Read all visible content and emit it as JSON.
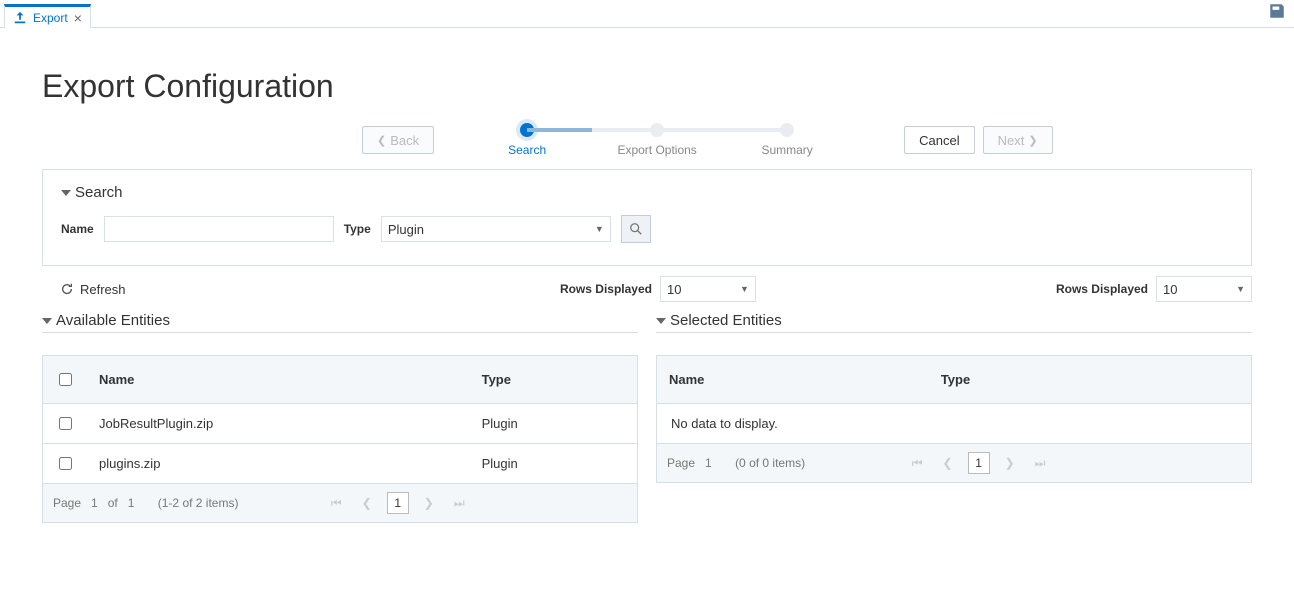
{
  "tab": {
    "label": "Export"
  },
  "page_title": "Export Configuration",
  "wizard": {
    "back": "Back",
    "cancel": "Cancel",
    "next": "Next",
    "steps": [
      {
        "label": "Search",
        "active": true
      },
      {
        "label": "Export Options",
        "active": false
      },
      {
        "label": "Summary",
        "active": false
      }
    ]
  },
  "search": {
    "heading": "Search",
    "name_label": "Name",
    "name_value": "",
    "type_label": "Type",
    "type_value": "Plugin"
  },
  "toolbar": {
    "refresh": "Refresh",
    "rows_displayed_label": "Rows Displayed",
    "rows_displayed_value": "10"
  },
  "available": {
    "heading": "Available Entities",
    "columns": {
      "name": "Name",
      "type": "Type"
    },
    "rows": [
      {
        "name": "JobResultPlugin.zip",
        "type": "Plugin"
      },
      {
        "name": "plugins.zip",
        "type": "Plugin"
      }
    ],
    "pager": {
      "page_label": "Page",
      "page": "1",
      "of_label": "of",
      "total_pages": "1",
      "range": "(1-2 of 2 items)"
    }
  },
  "selected": {
    "heading": "Selected Entities",
    "columns": {
      "name": "Name",
      "type": "Type"
    },
    "nodata": "No data to display.",
    "pager": {
      "page_label": "Page",
      "page": "1",
      "range": "(0 of 0 items)"
    }
  }
}
